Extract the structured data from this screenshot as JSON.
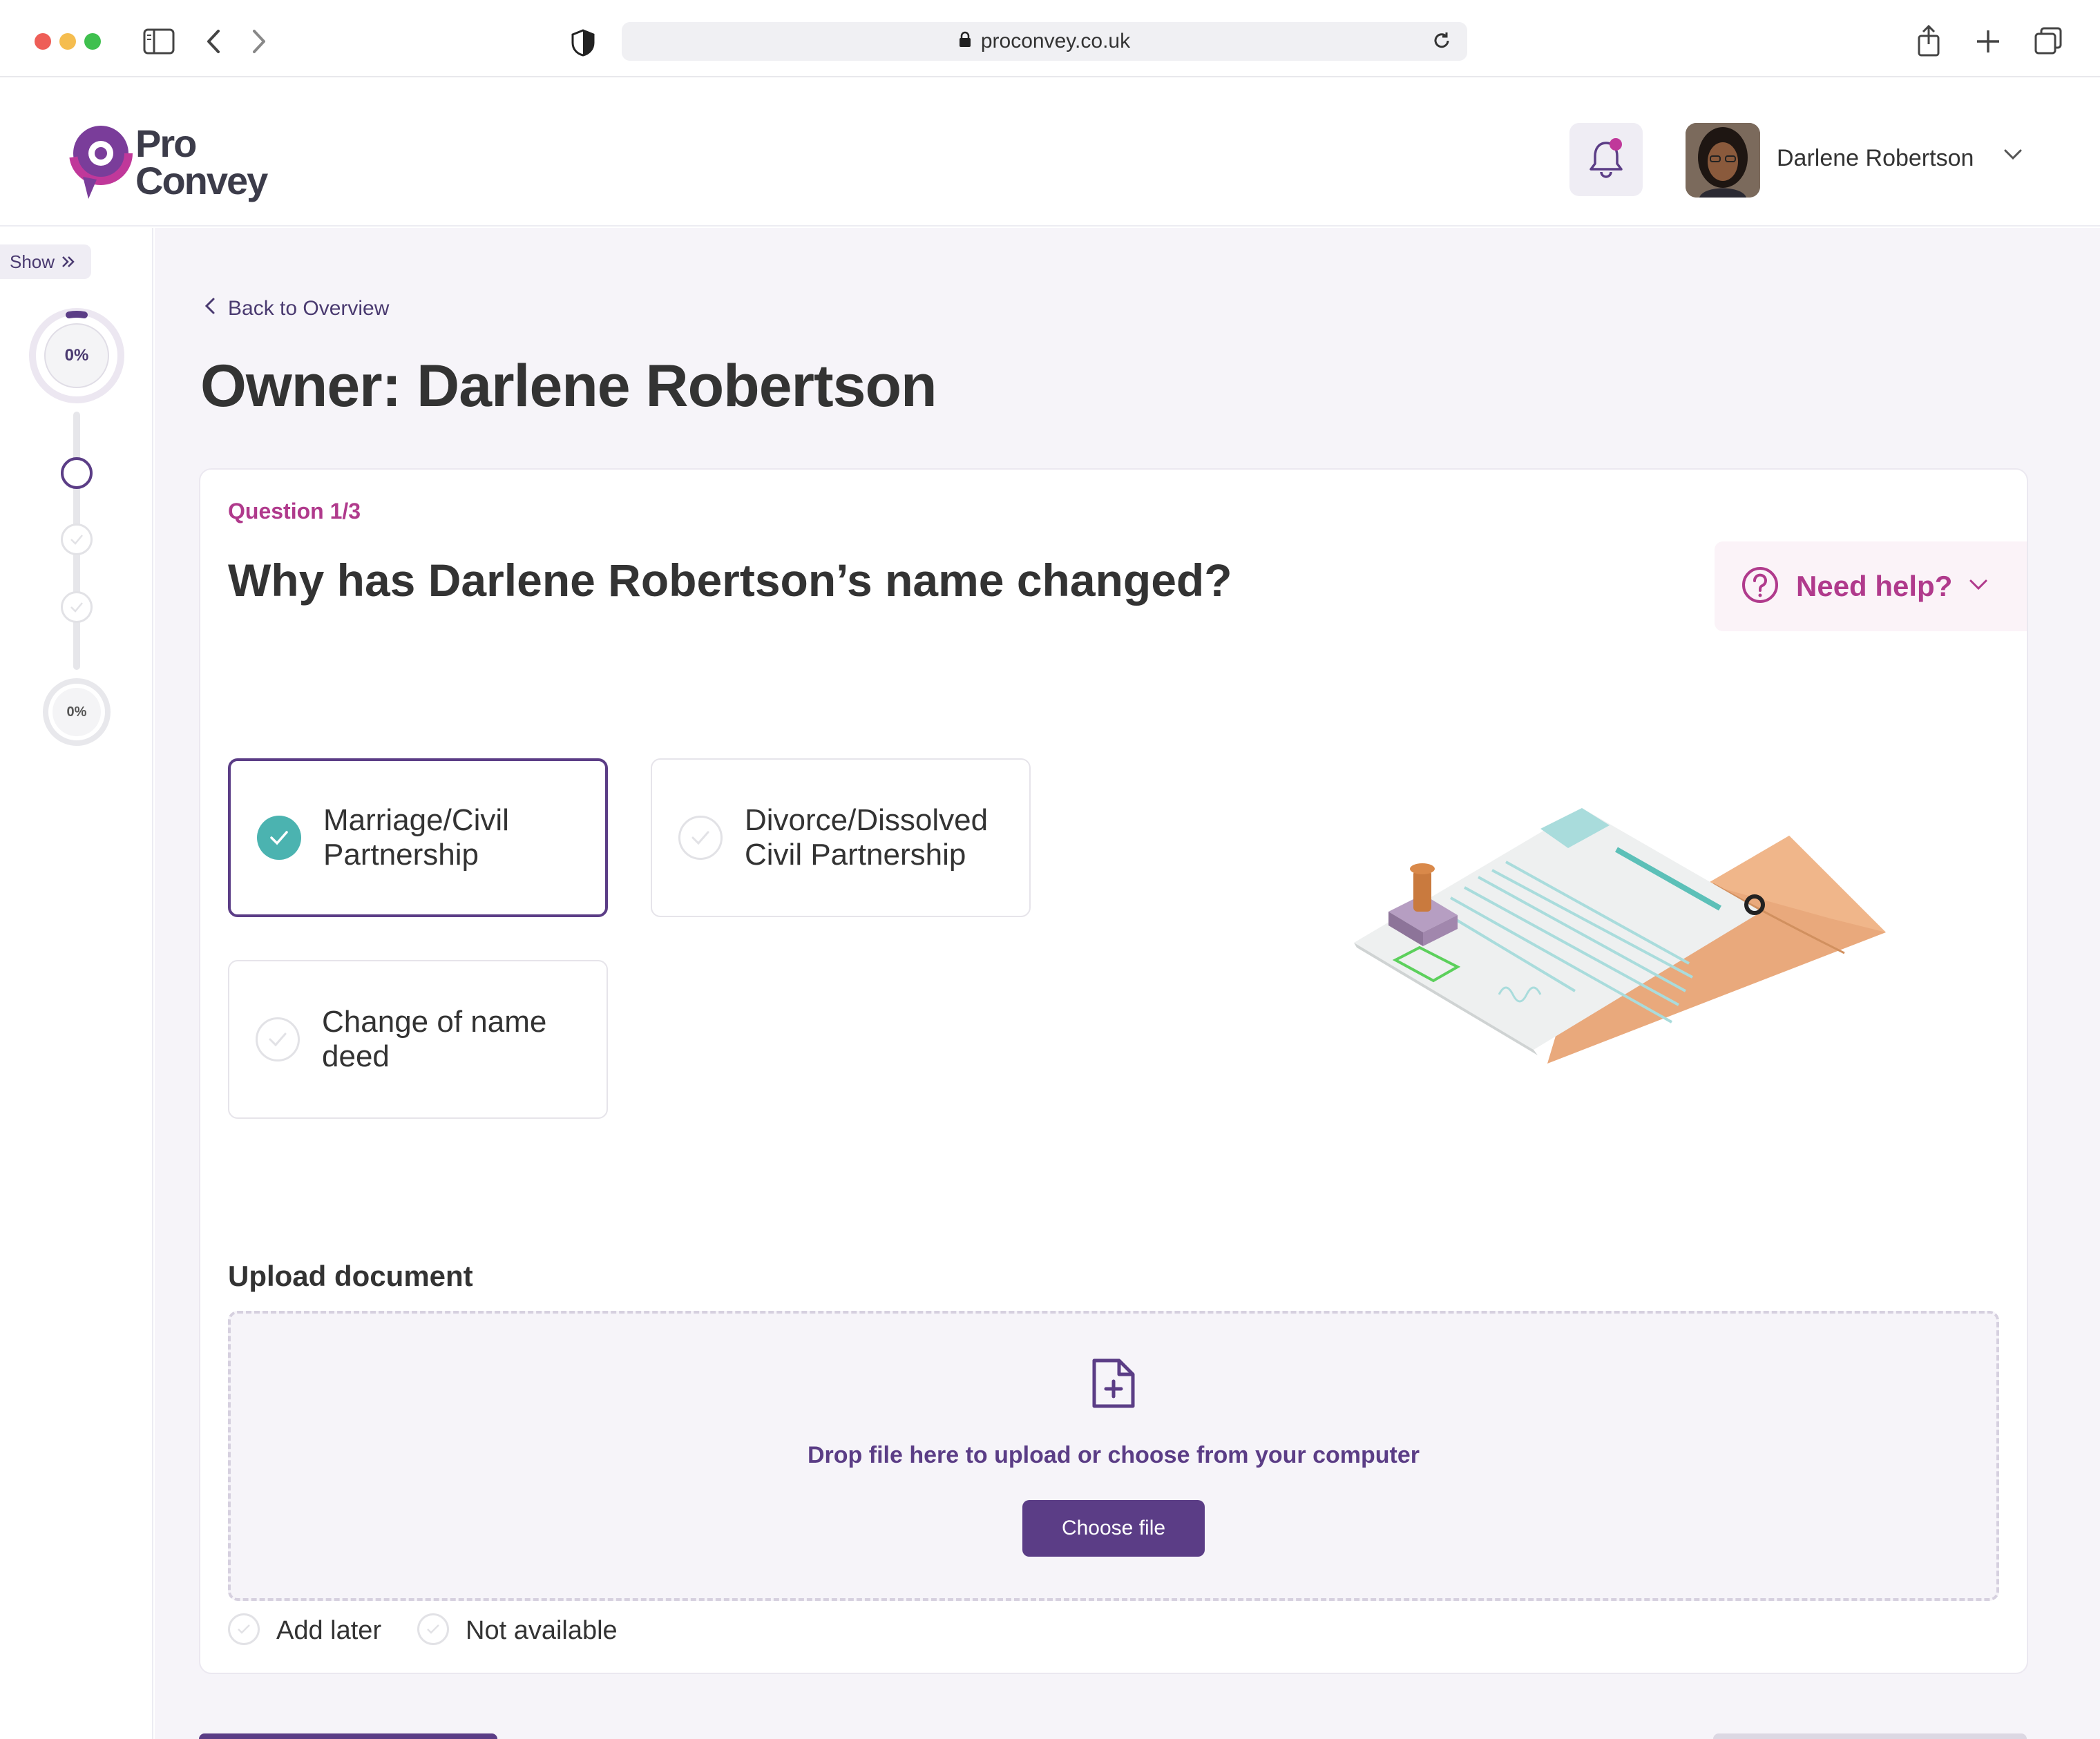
{
  "browser": {
    "url": "proconvey.co.uk",
    "traffic_colors": [
      "#ee5e57",
      "#f5bd4f",
      "#3fc04e"
    ]
  },
  "brand": {
    "logo_line1": "Pro",
    "logo_line2": "Convey",
    "accent": "#5b3d86",
    "pink": "#b03a8c",
    "teal": "#4bb3b0"
  },
  "header": {
    "user_name": "Darlene Robertson"
  },
  "rail": {
    "show_label": "Show",
    "progress_main": "0%",
    "progress_secondary": "0%"
  },
  "page": {
    "back_label": "Back to Overview",
    "title": "Owner: Darlene Robertson"
  },
  "question": {
    "counter": "Question 1/3",
    "text": "Why has Darlene Robertson’s name changed?",
    "help_label": "Need help?",
    "options": [
      {
        "label": "Marriage/Civil Partnership",
        "selected": true
      },
      {
        "label": "Divorce/Dissolved Civil Partnership",
        "selected": false
      },
      {
        "label": "Change of name deed",
        "selected": false
      }
    ]
  },
  "upload": {
    "title": "Upload document",
    "drop_text": "Drop file here to upload or choose from your computer",
    "button_label": "Choose file",
    "add_later_label": "Add later",
    "not_available_label": "Not available"
  }
}
